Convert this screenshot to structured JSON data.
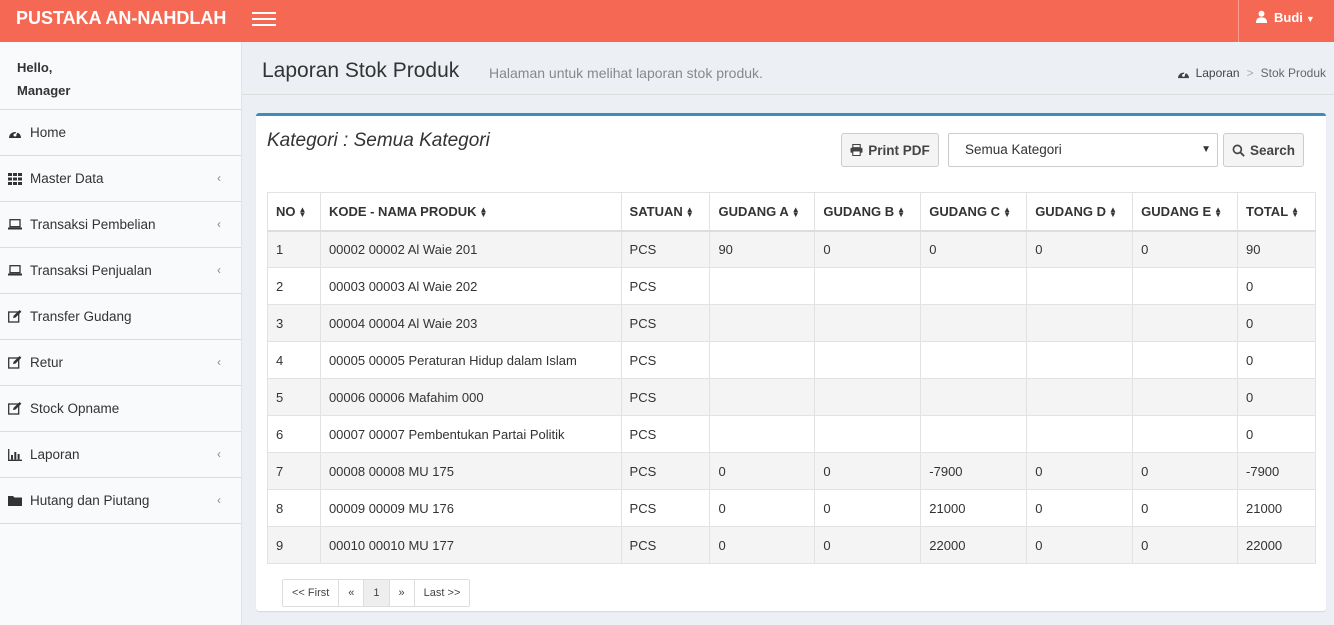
{
  "header": {
    "brand": "PUSTAKA AN-NAHDLAH",
    "user_name": "Budi"
  },
  "sidebar": {
    "greeting_line1": "Hello,",
    "greeting_line2": "Manager",
    "items": [
      {
        "label": "Home",
        "icon": "dashboard-icon",
        "has_children": false
      },
      {
        "label": "Master Data",
        "icon": "grid-icon",
        "has_children": true
      },
      {
        "label": "Transaksi Pembelian",
        "icon": "laptop-icon",
        "has_children": true
      },
      {
        "label": "Transaksi Penjualan",
        "icon": "laptop-icon",
        "has_children": true
      },
      {
        "label": "Transfer Gudang",
        "icon": "edit-icon",
        "has_children": false
      },
      {
        "label": "Retur",
        "icon": "edit-icon",
        "has_children": true
      },
      {
        "label": "Stock Opname",
        "icon": "edit-icon",
        "has_children": false
      },
      {
        "label": "Laporan",
        "icon": "bar-chart-icon",
        "has_children": true
      },
      {
        "label": "Hutang dan Piutang",
        "icon": "folder-icon",
        "has_children": true
      }
    ]
  },
  "page": {
    "title": "Laporan Stok Produk",
    "subtitle": "Halaman untuk melihat laporan stok produk.",
    "breadcrumb": [
      "Laporan",
      "Stok Produk"
    ]
  },
  "filter": {
    "kategori_label": "Kategori : Semua Kategori",
    "print_label": "Print PDF",
    "select_value": "Semua Kategori",
    "search_label": "Search"
  },
  "table": {
    "columns": [
      "NO",
      "KODE - NAMA PRODUK",
      "SATUAN",
      "GUDANG A",
      "GUDANG B",
      "GUDANG C",
      "GUDANG D",
      "GUDANG E",
      "TOTAL"
    ],
    "rows": [
      [
        "1",
        "00002 00002 Al Waie 201",
        "PCS",
        "90",
        "0",
        "0",
        "0",
        "0",
        "90"
      ],
      [
        "2",
        "00003 00003 Al Waie 202",
        "PCS",
        "",
        "",
        "",
        "",
        "",
        "0"
      ],
      [
        "3",
        "00004 00004 Al Waie 203",
        "PCS",
        "",
        "",
        "",
        "",
        "",
        "0"
      ],
      [
        "4",
        "00005 00005 Peraturan Hidup dalam Islam",
        "PCS",
        "",
        "",
        "",
        "",
        "",
        "0"
      ],
      [
        "5",
        "00006 00006 Mafahim 000",
        "PCS",
        "",
        "",
        "",
        "",
        "",
        "0"
      ],
      [
        "6",
        "00007 00007 Pembentukan Partai Politik",
        "PCS",
        "",
        "",
        "",
        "",
        "",
        "0"
      ],
      [
        "7",
        "00008 00008 MU 175",
        "PCS",
        "0",
        "0",
        "-7900",
        "0",
        "0",
        "-7900"
      ],
      [
        "8",
        "00009 00009 MU 176",
        "PCS",
        "0",
        "0",
        "21000",
        "0",
        "0",
        "21000"
      ],
      [
        "9",
        "00010 00010 MU 177",
        "PCS",
        "0",
        "0",
        "22000",
        "0",
        "0",
        "22000"
      ]
    ]
  },
  "pagination": {
    "first": "<< First",
    "prev": "«",
    "current": "1",
    "next": "»",
    "last": "Last >>"
  },
  "colors": {
    "header_bg": "#f56954",
    "box_accent": "#3c8dbc",
    "content_bg": "#ecf0f5"
  }
}
